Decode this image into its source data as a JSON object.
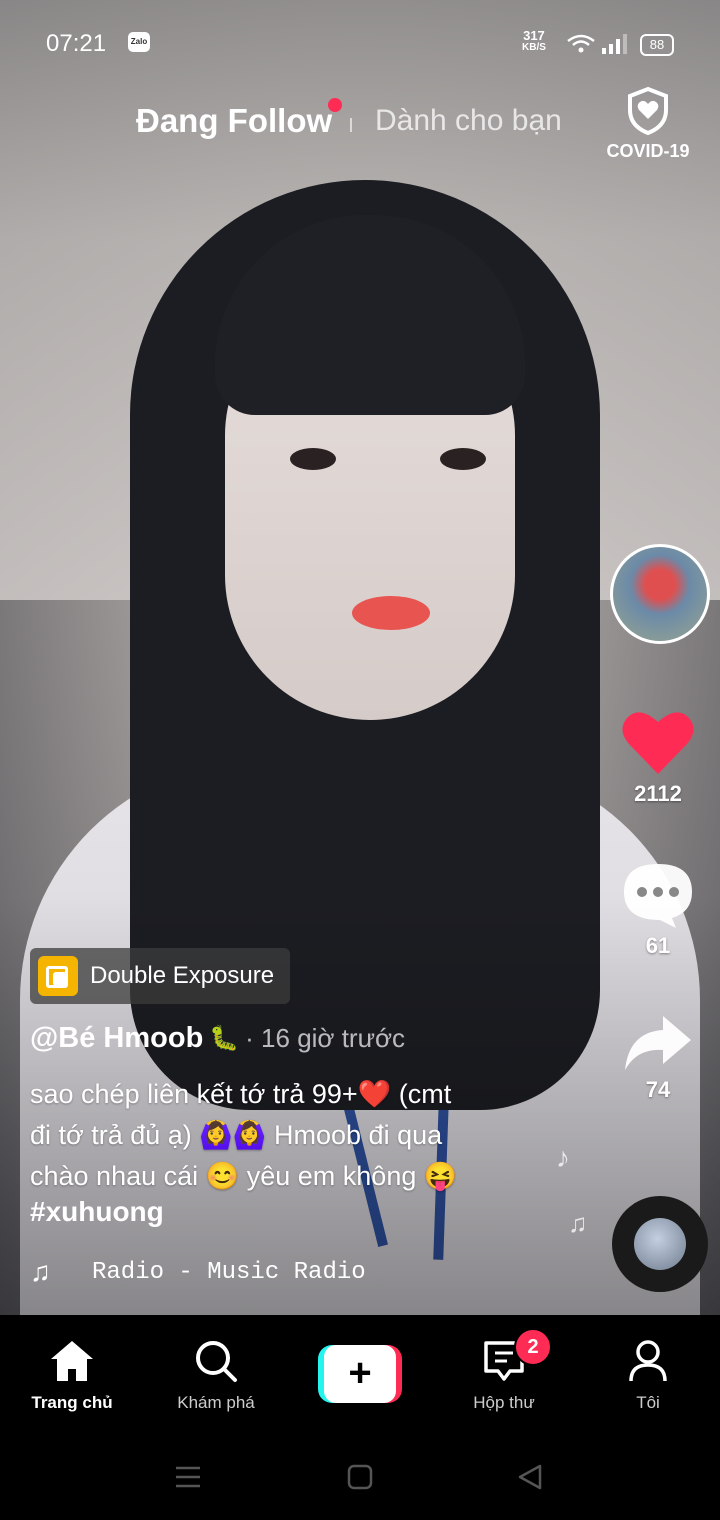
{
  "status_bar": {
    "time": "07:21",
    "notification_app": "Zalo",
    "net_speed": "317",
    "net_unit": "KB/S",
    "battery": "88"
  },
  "top_tabs": {
    "following": "Đang Follow",
    "for_you": "Dành cho bạn",
    "covid_label": "COVID-19"
  },
  "right_rail": {
    "likes": "2112",
    "comments": "61",
    "shares": "74"
  },
  "post": {
    "effect": "Double Exposure",
    "username": "@Bé Hmoob",
    "user_emoji": "🐛",
    "time_ago": "· 16 giờ trước",
    "caption_line1": "sao chép liên kết tớ trả 99+❤️ (cmt",
    "caption_line2": "đi tớ trả đủ ạ) 🙆‍♀️🙆‍♀️ Hmoob đi qua",
    "caption_line3": "chào nhau cái 😊 yêu em không 😝",
    "hashtag": "#xuhuong",
    "music": "Radio - Music Radio"
  },
  "bottom_nav": {
    "home": "Trang chủ",
    "discover": "Khám phá",
    "create": "+",
    "inbox": "Hộp thư",
    "inbox_badge": "2",
    "profile": "Tôi"
  },
  "colors": {
    "accent_red": "#fe2c55",
    "accent_cyan": "#25f4ee",
    "effect_yellow": "#f5b400"
  }
}
